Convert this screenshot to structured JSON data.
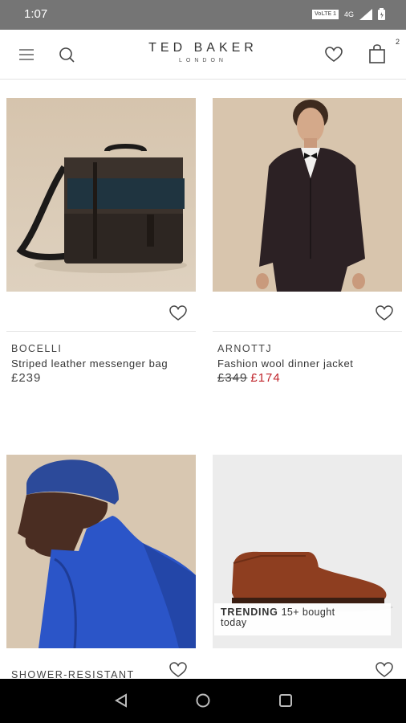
{
  "status_bar": {
    "time": "1:07",
    "network_badge": "VoLTE 1",
    "signal_label": "4G"
  },
  "header": {
    "brand_name": "TED BAKER",
    "brand_sub": "LONDON",
    "cart_count": "2",
    "icons": [
      "menu-icon",
      "search-icon",
      "heart-icon",
      "shopping-bag-icon"
    ]
  },
  "products": [
    {
      "brand": "BOCELLI",
      "name": "Striped leather messenger bag",
      "price": "£239"
    },
    {
      "brand": "ARNOTTJ",
      "name": "Fashion wool dinner jacket",
      "price_old": "£349",
      "price_sale": "£174"
    },
    {
      "brand": "SHOWER-RESISTANT"
    },
    {
      "trending_label": "TRENDING",
      "trending_text": "15+ bought",
      "trending_text2": "today"
    }
  ],
  "colors": {
    "status_bar": "#757575",
    "sale_price": "#c0262d",
    "nav_bar": "#000000"
  }
}
